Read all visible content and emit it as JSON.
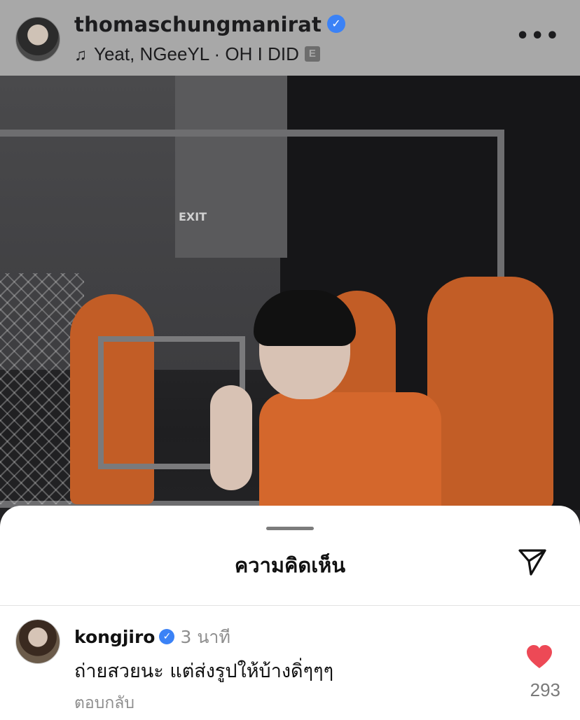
{
  "post": {
    "username": "thomaschungmanirat",
    "song": "Yeat, NGeeYL · OH I DID",
    "explicit_badge": "E",
    "more_icon": "more-horizontal-icon",
    "photo_signs": {
      "exit": "EXIT"
    }
  },
  "comments_sheet": {
    "title": "ความคิดเห็น",
    "share_icon": "paper-plane-icon",
    "comment": {
      "username": "kongjiro",
      "time": "3 นาที",
      "text": "ถ่ายสวยนะ แต่ส่งรูปให้บ้างดิ่ๆๆๆ",
      "reply_label": "ตอบกลับ",
      "like_icon": "heart-icon",
      "like_count": "293",
      "like_color": "#ed4956"
    }
  },
  "colors": {
    "verified": "#3b82f6",
    "header_bg": "#a8a8a8",
    "sheet_bg": "#ffffff"
  }
}
